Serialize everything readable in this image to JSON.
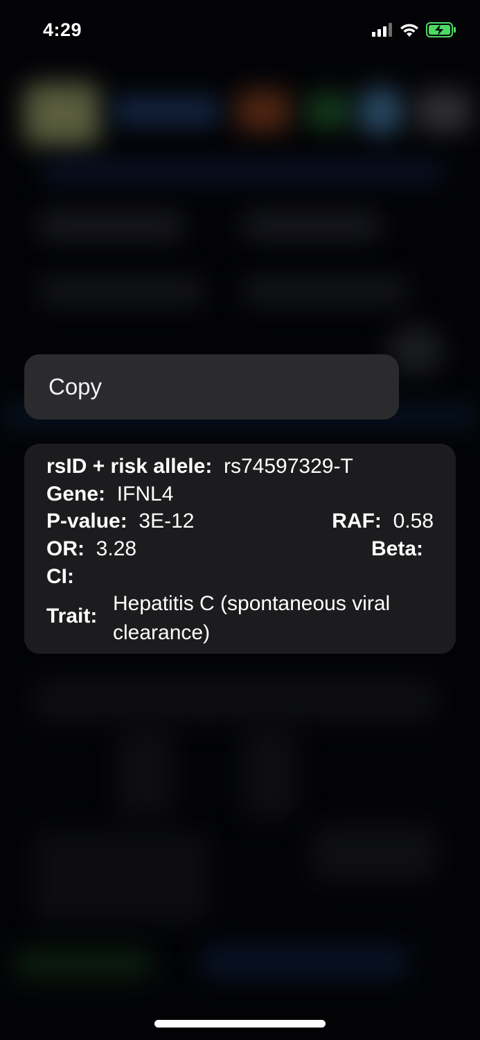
{
  "status_bar": {
    "time": "4:29",
    "icons": [
      "cellular-signal-icon",
      "wifi-icon",
      "battery-charging-icon"
    ],
    "battery_color": "#4cd964"
  },
  "context_menu": {
    "items": [
      {
        "label": "Copy"
      }
    ]
  },
  "preview": {
    "rsid_label": "rsID + risk allele:",
    "rsid_value": "rs74597329-T",
    "gene_label": "Gene:",
    "gene_value": "IFNL4",
    "pvalue_label": "P-value:",
    "pvalue_value": "3E-12",
    "raf_label": "RAF:",
    "raf_value": "0.58",
    "or_label": "OR:",
    "or_value": "3.28",
    "beta_label": "Beta:",
    "beta_value": "",
    "ci_label": "CI:",
    "ci_value": "",
    "trait_label": "Trait:",
    "trait_value": "Hepatitis C (spontaneous viral clearance)"
  }
}
